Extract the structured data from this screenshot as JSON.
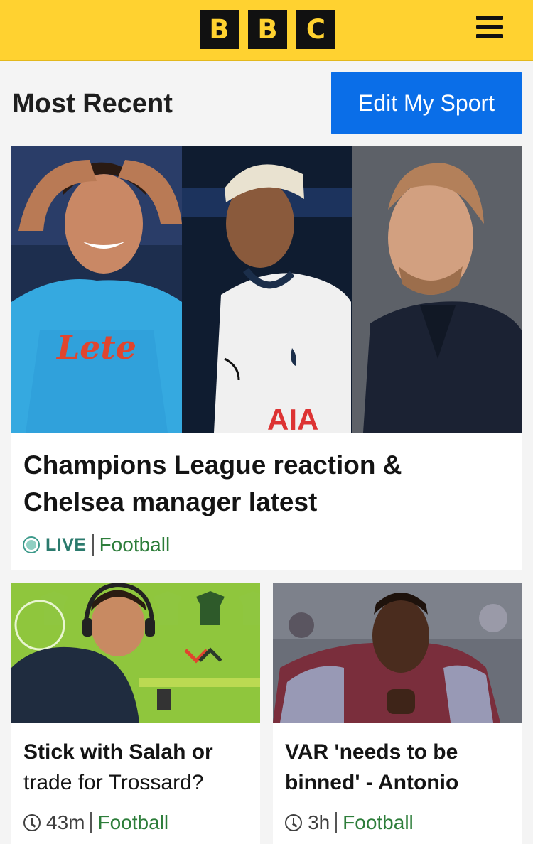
{
  "header": {
    "logo_letters": [
      "B",
      "B",
      "C"
    ],
    "menu_icon": "hamburger-menu-icon",
    "background_color": "#ffd230"
  },
  "section": {
    "title": "Most Recent",
    "edit_button_label": "Edit My Sport",
    "edit_button_color": "#0a6ee8"
  },
  "hero_story": {
    "image_description_icon": "photo-collage",
    "title": "Champions League reaction & Chelsea manager latest",
    "live_label": "LIVE",
    "category": "Football",
    "status_icon": "live-indicator-icon"
  },
  "stories": [
    {
      "title_part1": "Stick with Salah or",
      "title_part2": "trade for Trossard?",
      "time": "43m",
      "category": "Football",
      "time_icon": "clock-icon"
    },
    {
      "title_part1": "VAR 'needs to be",
      "title_part2": "binned' - Antonio",
      "time": "3h",
      "category": "Football",
      "time_icon": "clock-icon"
    }
  ],
  "colors": {
    "live_accent": "#2b7a6d",
    "category_link": "#2d7d3a"
  }
}
